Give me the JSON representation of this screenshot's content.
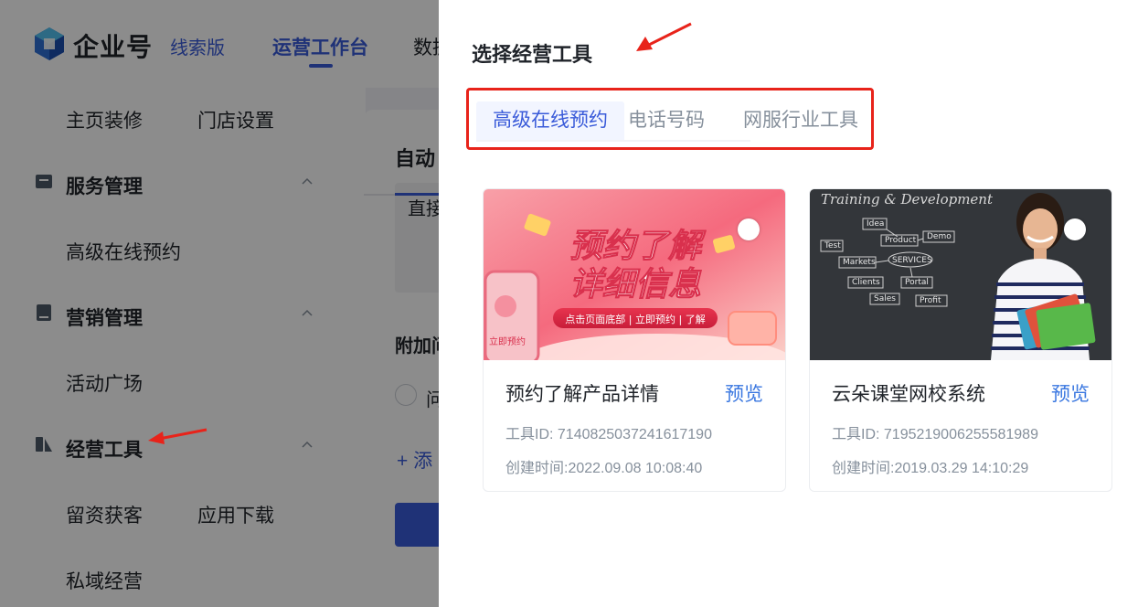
{
  "app": {
    "brand": "企业号",
    "edition": "线索版",
    "nav": {
      "workbench": "运营工作台",
      "data_partial": "数据"
    }
  },
  "sidebar": {
    "homepage_decor": "主页装修",
    "store_settings": "门店设置",
    "service_mgmt": "服务管理",
    "advanced_booking": "高级在线预约",
    "marketing_mgmt": "营销管理",
    "activity_square": "活动广场",
    "business_tools": "经营工具",
    "lead_capture": "留资获客",
    "app_download": "应用下载",
    "private_domain": "私域经营"
  },
  "content": {
    "title_partial": "自动",
    "box_text_partial": "直接",
    "attach_partial": "附加问",
    "radio_partial": "问",
    "add_partial": "+ 添"
  },
  "drawer": {
    "title": "选择经营工具",
    "tabs": [
      {
        "label": "高级在线预约",
        "active": true
      },
      {
        "label": "电话号码",
        "active": false
      },
      {
        "label": "网服行业工具",
        "active": false
      }
    ],
    "cards": [
      {
        "name": "预约了解产品详情",
        "preview": "预览",
        "tool_id": "工具ID: 7140825037241617190",
        "created": "创建时间:2022.09.08 10:08:40",
        "banner": {
          "line1": "预约了解",
          "line2": "详细信息",
          "strip": "点击页面底部 | 立即预约 | 了解",
          "phone_btn": "立即预约"
        }
      },
      {
        "name": "云朵课堂网校系统",
        "preview": "预览",
        "tool_id": "工具ID: 7195219006255581989",
        "created": "创建时间:2019.03.29 14:10:29",
        "banner": {
          "heading": "Training & Development",
          "words": [
            "Idea",
            "Product",
            "Demo",
            "Test",
            "Markets",
            "SERVICES",
            "Portal",
            "Clients",
            "Sales",
            "Profit"
          ]
        }
      }
    ]
  },
  "colors": {
    "accent": "#3a5bd9",
    "link": "#3a77e0",
    "highlight_red": "#e8231a",
    "muted": "#86909c"
  }
}
